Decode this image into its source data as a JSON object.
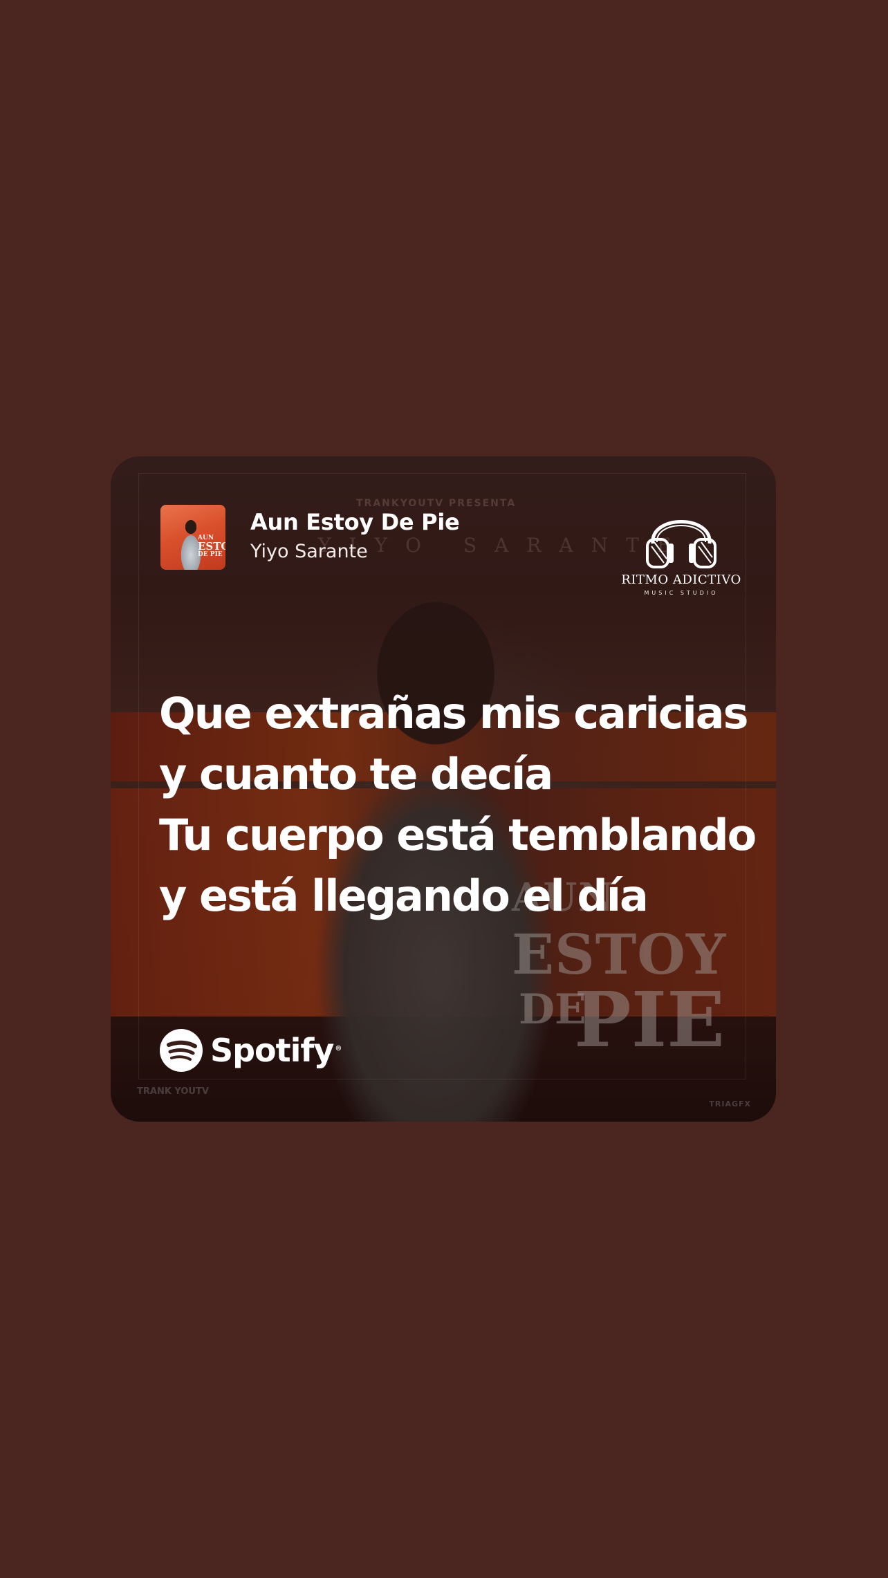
{
  "track": {
    "title": "Aun Estoy De Pie",
    "artist": "Yiyo Sarante"
  },
  "album_art": {
    "presenta": "TRANKYOUTV PRESENTA",
    "artist_spaced": "YIYO SARANTE",
    "title_line1": "AUN",
    "title_line2": "ESTOY",
    "title_line3a": "DE",
    "title_line3b": "PIE",
    "credit_left": "TRANK YOUTV",
    "credit_right": "TRIAGFX"
  },
  "cover_thumbnail": {
    "line1": "AUN",
    "line2": "ESTOY",
    "line3": "DE PIE"
  },
  "logo": {
    "title": "RITMO ADICTIVO",
    "subtitle": "MUSIC STUDIO",
    "icon": "headphones-icon"
  },
  "lyrics": [
    "Que extrañas mis caricias",
    "y cuanto te decía",
    "Tu cuerpo está temblando",
    "y está llegando el día"
  ],
  "brand": {
    "name": "Spotify",
    "registered": "®",
    "icon": "spotify-icon"
  },
  "colors": {
    "page_background": "#4b2620",
    "text": "#ffffff"
  }
}
